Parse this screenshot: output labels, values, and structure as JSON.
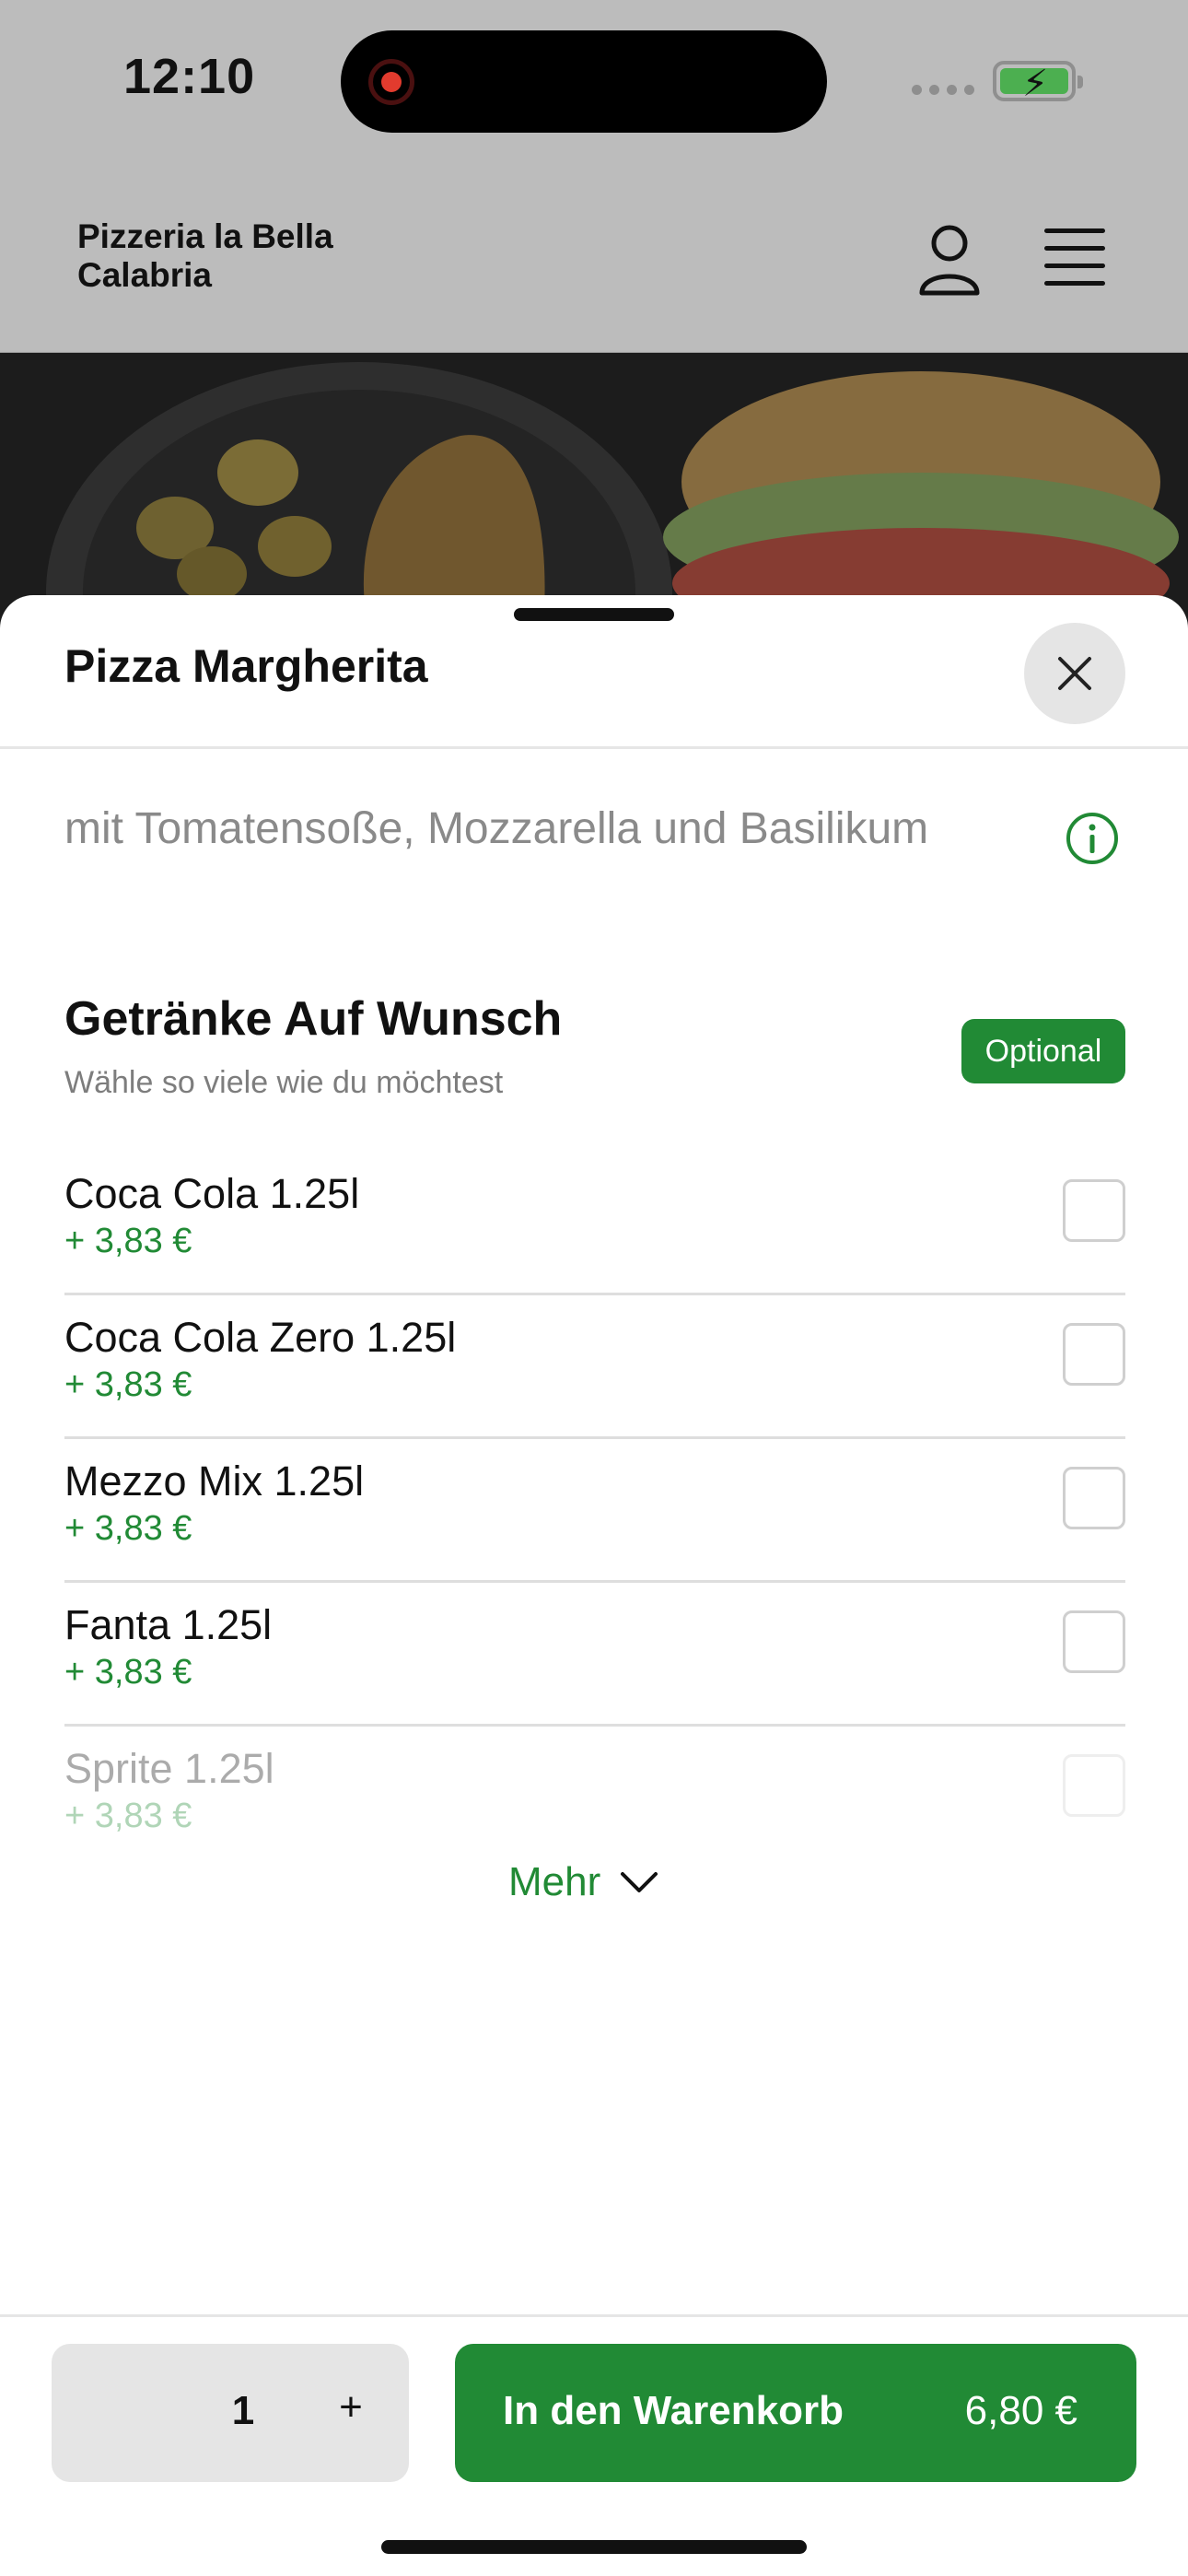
{
  "status": {
    "time": "12:10"
  },
  "header": {
    "brand": "Pizzeria la Bella Calabria",
    "icons": [
      "user-icon",
      "menu-icon"
    ]
  },
  "sheet": {
    "title": "Pizza Margherita",
    "description": "mit Tomatensoße, Mozzarella und Basilikum",
    "group": {
      "title": "Getränke Auf Wunsch",
      "subtitle": "Wähle so viele wie du möchtest",
      "badge": "Optional"
    },
    "options": [
      {
        "name": "Coca Cola 1.25l",
        "price": "+ 3,83 €"
      },
      {
        "name": "Coca Cola Zero 1.25l",
        "price": "+ 3,83 €"
      },
      {
        "name": "Mezzo Mix 1.25l",
        "price": "+ 3,83 €"
      },
      {
        "name": "Fanta 1.25l",
        "price": "+ 3,83 €"
      },
      {
        "name": "Sprite 1.25l",
        "price": "+ 3,83 €"
      }
    ],
    "more_label": "Mehr"
  },
  "footer": {
    "quantity": "1",
    "plus": "+",
    "cart_label": "In den Warenkorb",
    "cart_price": "6,80 €"
  },
  "colors": {
    "accent": "#218a35",
    "overlay": "#bcbcbc"
  }
}
